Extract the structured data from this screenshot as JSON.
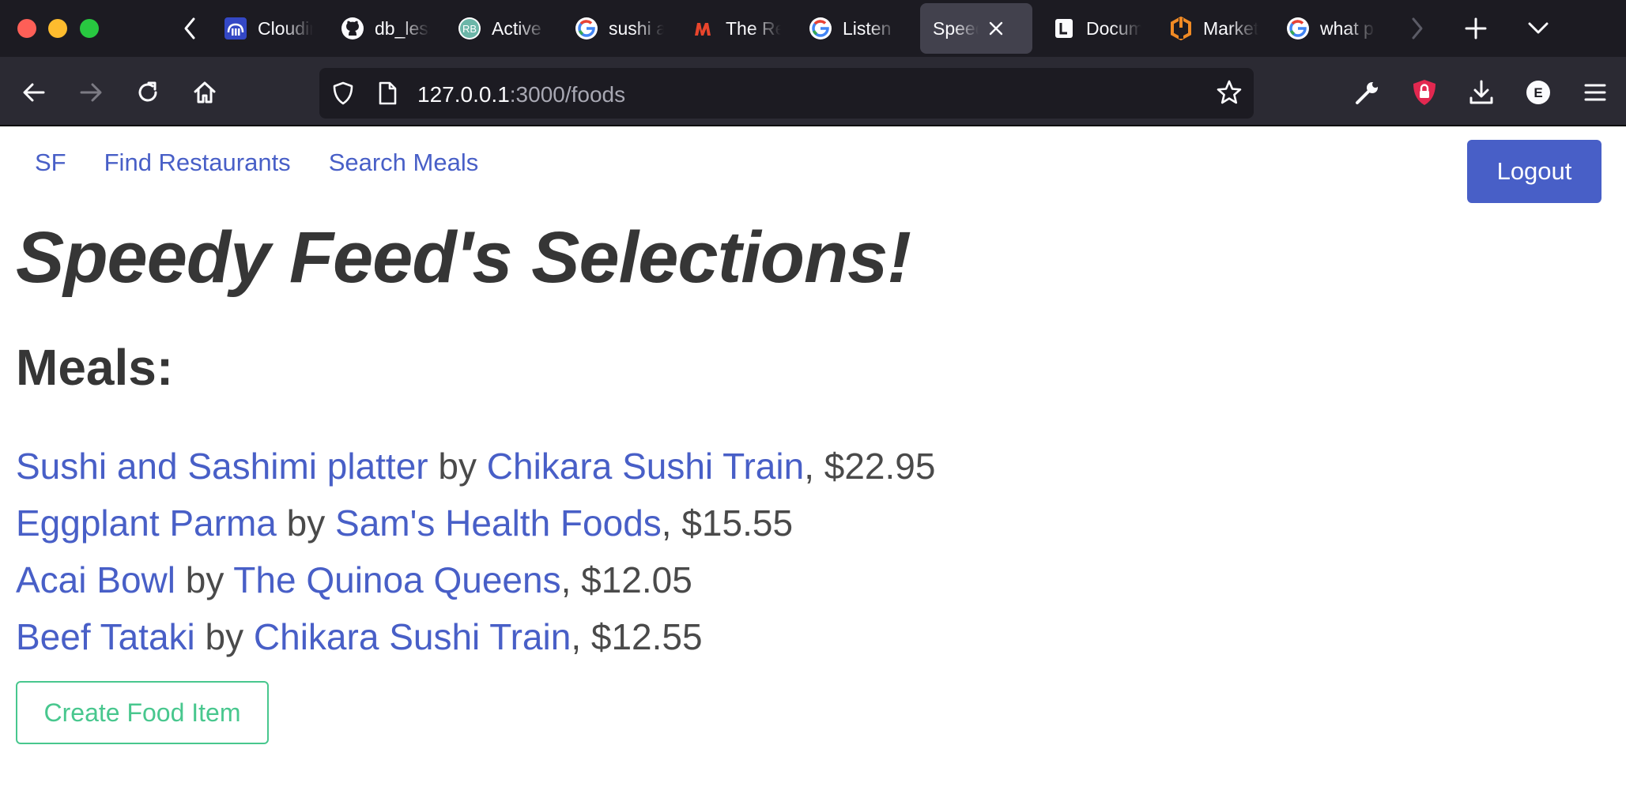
{
  "browser": {
    "tabs": [
      {
        "label": "Cloudinary",
        "icon": "cloudinary-icon"
      },
      {
        "label": "db_lesson",
        "icon": "github-icon"
      },
      {
        "label": "Active",
        "icon": "rb-icon"
      },
      {
        "label": "sushi and",
        "icon": "google-icon"
      },
      {
        "label": "The Red",
        "icon": "m-logo-icon"
      },
      {
        "label": "Listen",
        "icon": "google-icon"
      },
      {
        "label": "Speedy Feed",
        "icon": "",
        "active": true
      },
      {
        "label": "Documents",
        "icon": "document-icon"
      },
      {
        "label": "Market",
        "icon": "orange-hex-icon"
      },
      {
        "label": "what p",
        "icon": "google-icon"
      }
    ],
    "url_host": "127.0.0.1",
    "url_path": ":3000/foods",
    "account_initial": "E"
  },
  "site": {
    "nav": {
      "brand": "SF",
      "find_restaurants": "Find Restaurants",
      "search_meals": "Search Meals",
      "logout": "Logout"
    },
    "heading": "Speedy Feed's Selections!",
    "meals_heading": "Meals:",
    "by_word": "by",
    "meals": [
      {
        "name": "Sushi and Sashimi platter",
        "restaurant": "Chikara Sushi Train",
        "price": "$22.95"
      },
      {
        "name": "Eggplant Parma",
        "restaurant": "Sam's Health Foods",
        "price": "$15.55"
      },
      {
        "name": "Acai Bowl",
        "restaurant": "The Quinoa Queens",
        "price": "$12.05"
      },
      {
        "name": "Beef Tataki",
        "restaurant": "Chikara Sushi Train",
        "price": "$12.55"
      }
    ],
    "create_button": "Create Food Item"
  },
  "colors": {
    "link": "#485fc7",
    "primary_button": "#485fc7",
    "create_outline": "#48c78e",
    "text": "#363636"
  }
}
